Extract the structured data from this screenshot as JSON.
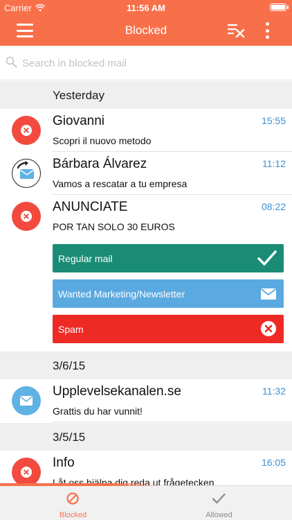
{
  "status_bar": {
    "carrier": "Carrier",
    "time": "11:56 AM"
  },
  "nav": {
    "title": "Blocked"
  },
  "search": {
    "placeholder": "Search in blocked mail",
    "value": ""
  },
  "sections": [
    "Yesterday",
    "3/6/15",
    "3/5/15"
  ],
  "messages": [
    {
      "sender": "Giovanni",
      "time": "15:55",
      "preview": "Scopri il nuovo metodo",
      "avatar": "blocked-icon"
    },
    {
      "sender": "Bárbara Álvarez",
      "time": "11:12",
      "preview": "Vamos a rescatar a tu empresa",
      "avatar": "redirect-mail-icon"
    },
    {
      "sender": "ANUNCIATE",
      "time": "08:22",
      "preview": "POR TAN SOLO 30 EUROS",
      "avatar": "blocked-icon"
    },
    {
      "sender": "Upplevelsekanalen.se",
      "time": "11:32",
      "preview": "Grattis du har vunnit!",
      "avatar": "mail-icon"
    },
    {
      "sender": "Info",
      "time": "16:05",
      "preview": "Låt oss hjälpa dig reda ut frågetecken",
      "avatar": "blocked-icon"
    }
  ],
  "actions": {
    "regular": "Regular mail",
    "wanted": "Wanted Marketing/Newsletter",
    "spam": "Spam"
  },
  "tabs": {
    "blocked": "Blocked",
    "allowed": "Allowed"
  },
  "colors": {
    "accent": "#f8704a",
    "blocked_red": "#f24a3f",
    "regular_green": "#1a8c76",
    "wanted_blue": "#5aa9e0",
    "spam_red": "#ee2a25",
    "time_blue": "#3d8fd0"
  }
}
